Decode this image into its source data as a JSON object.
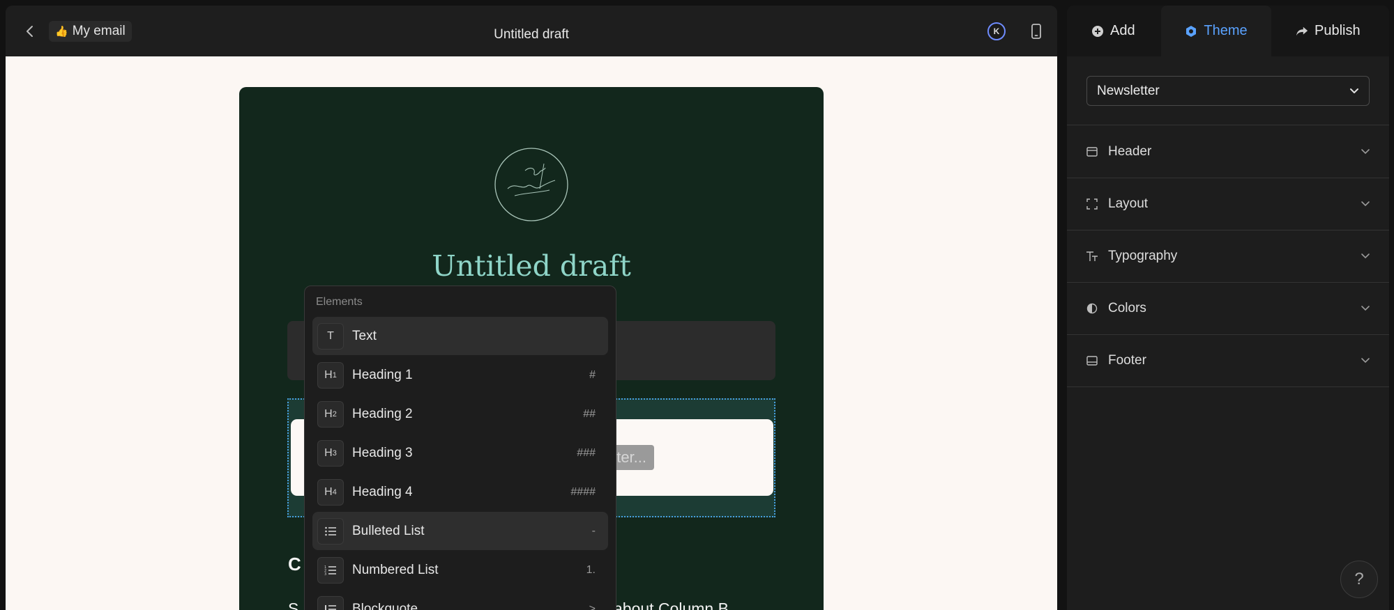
{
  "editor": {
    "back_icon": "chevron-left-icon",
    "email_pill": {
      "emoji": "👍",
      "label": "My email"
    },
    "doc_title": "Untitled draft",
    "avatar_initial": "K",
    "device_icon": "mobile-phone-icon"
  },
  "email": {
    "title": "Untitled draft",
    "filter_placeholder": "Filter...",
    "column_letter": "C",
    "column_text_start": "S",
    "column_text": "about Column B.",
    "logo_icon": "signature-logo-icon"
  },
  "elements_menu": {
    "heading": "Elements",
    "items": [
      {
        "icon": "T",
        "label": "Text",
        "shortcut": "",
        "highlighted": true
      },
      {
        "icon": "H1",
        "label": "Heading 1",
        "shortcut": "#",
        "highlighted": false
      },
      {
        "icon": "H2",
        "label": "Heading 2",
        "shortcut": "##",
        "highlighted": false
      },
      {
        "icon": "H3",
        "label": "Heading 3",
        "shortcut": "###",
        "highlighted": false
      },
      {
        "icon": "H4",
        "label": "Heading 4",
        "shortcut": "####",
        "highlighted": false
      },
      {
        "icon": "bullet-list-icon",
        "label": "Bulleted List",
        "shortcut": "-",
        "highlighted": true
      },
      {
        "icon": "numbered-list-icon",
        "label": "Numbered List",
        "shortcut": "1.",
        "highlighted": false
      },
      {
        "icon": "blockquote-icon",
        "label": "Blockquote",
        "shortcut": ">",
        "highlighted": false
      }
    ]
  },
  "sidebar": {
    "tabs": [
      {
        "label": "Add",
        "icon": "plus-circle-icon"
      },
      {
        "label": "Theme",
        "icon": "theme-icon",
        "active": true
      },
      {
        "label": "Publish",
        "icon": "share-arrow-icon"
      }
    ],
    "theme_select": "Newsletter",
    "sections": [
      {
        "label": "Header",
        "icon": "header-icon"
      },
      {
        "label": "Layout",
        "icon": "layout-icon"
      },
      {
        "label": "Typography",
        "icon": "typography-icon"
      },
      {
        "label": "Colors",
        "icon": "contrast-icon"
      },
      {
        "label": "Footer",
        "icon": "footer-icon"
      }
    ],
    "help_label": "?"
  },
  "colors": {
    "accent": "#5aa2ff",
    "email_bg": "#12271c",
    "title_color": "#8fd5c8",
    "canvas_bg": "#fcf7f3"
  }
}
